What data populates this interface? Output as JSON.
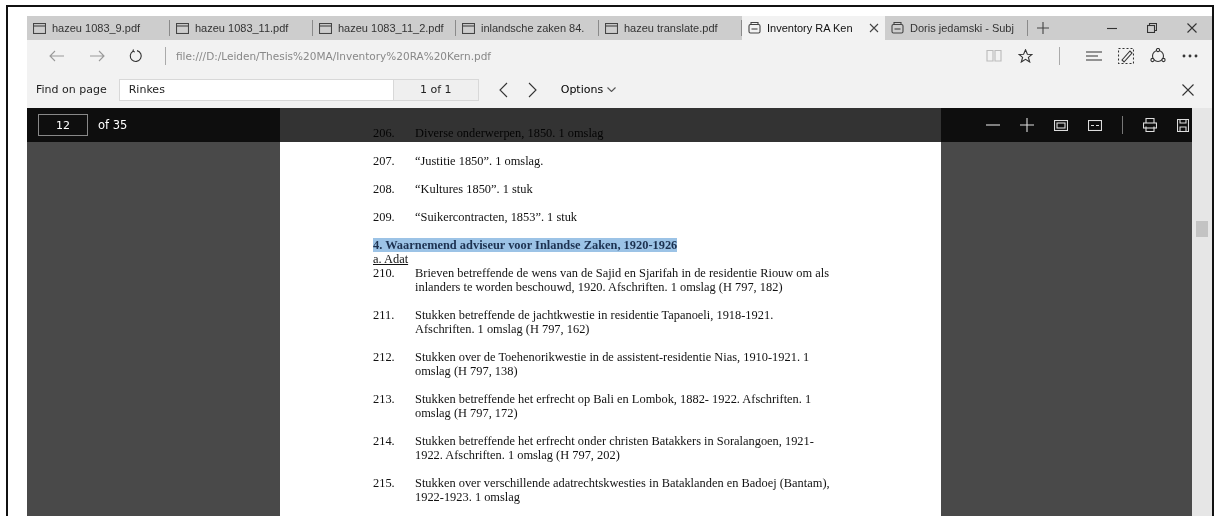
{
  "tabs": [
    {
      "label": "hazeu 1083_9.pdf",
      "kind": "page",
      "selected": false
    },
    {
      "label": "hazeu 1083_11.pdf",
      "kind": "page",
      "selected": false
    },
    {
      "label": "hazeu 1083_11_2.pdf",
      "kind": "page",
      "selected": false
    },
    {
      "label": "inlandsche zaken 84.",
      "kind": "page",
      "selected": false
    },
    {
      "label": "hazeu translate.pdf",
      "kind": "page",
      "selected": false
    },
    {
      "label": "Inventory RA Ken",
      "kind": "pdf",
      "selected": true
    },
    {
      "label": "Doris jedamski - Subj",
      "kind": "pdf",
      "selected": false
    }
  ],
  "address_bar": {
    "url": "file:///D:/Leiden/Thesis%20MA/Inventory%20RA%20Kern.pdf"
  },
  "find_bar": {
    "label": "Find on page",
    "value": "Rinkes",
    "count": "1 of 1",
    "options": "Options"
  },
  "pdf_toolbar": {
    "page_number": "12",
    "page_total": "of 35"
  },
  "document": [
    {
      "kind": "entry",
      "number": "206.",
      "lines": [
        "Diverse onderwerpen, 1850. 1 omslag"
      ]
    },
    {
      "kind": "entry",
      "number": "207.",
      "lines": [
        "“Justitie 1850”. 1 omslag."
      ]
    },
    {
      "kind": "entry",
      "number": "208.",
      "lines": [
        "“Kultures 1850”. 1 stuk"
      ]
    },
    {
      "kind": "entry",
      "number": "209.",
      "lines": [
        "“Suikercontracten, 1853”. 1 stuk"
      ]
    },
    {
      "kind": "heading",
      "text": "4. Waarnemend adviseur voor Inlandse Zaken, 1920-1926",
      "highlighted": true
    },
    {
      "kind": "subheading",
      "text": "a. Adat"
    },
    {
      "kind": "entry",
      "number": "210.",
      "lines": [
        "Brieven betreffende de wens van de Sajid en Sjarifah in de residentie Riouw om als",
        "inlanders te worden beschouwd, 1920. Afschriften. 1 omslag (H 797, 182)"
      ]
    },
    {
      "kind": "entry",
      "number": "211.",
      "lines": [
        "Stukken betreffende de jachtkwestie in residentie Tapanoeli, 1918-1921.",
        "Afschriften. 1 omslag (H 797, 162)"
      ]
    },
    {
      "kind": "entry",
      "number": "212.",
      "lines": [
        "Stukken over de Toehenorikwestie in de assistent-residentie Nias, 1910-1921. 1",
        "omslag (H 797, 138)"
      ]
    },
    {
      "kind": "entry",
      "number": "213.",
      "lines": [
        "Stukken betreffende het erfrecht op Bali en Lombok, 1882- 1922. Afschriften. 1",
        "omslag (H 797, 172)"
      ]
    },
    {
      "kind": "entry",
      "number": "214.",
      "lines": [
        "Stukken betreffende het erfrecht onder christen Batakkers in Soralangoen, 1921-",
        "1922. Afschriften. 1 omslag (H 797, 202)"
      ]
    },
    {
      "kind": "entry",
      "number": "215.",
      "lines": [
        "Stukken over verschillende adatrechtskwesties in Bataklanden en Badoej (Bantam),",
        "1922-1923. 1 omslag"
      ]
    }
  ]
}
